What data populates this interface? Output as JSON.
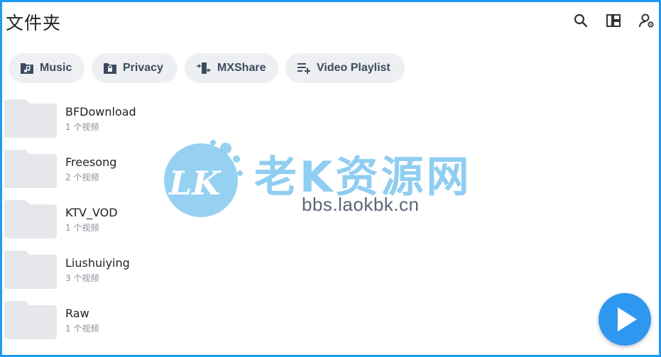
{
  "header": {
    "title": "文件夹",
    "icons": [
      "search-icon",
      "layout-icon",
      "account-settings-icon"
    ]
  },
  "chips": [
    {
      "label": "Music",
      "icon": "music-folder-icon"
    },
    {
      "label": "Privacy",
      "icon": "lock-folder-icon"
    },
    {
      "label": "MXShare",
      "icon": "share-transfer-icon"
    },
    {
      "label": "Video Playlist",
      "icon": "playlist-add-icon"
    }
  ],
  "folders": [
    {
      "name": "BFDownload",
      "count": "1 个视频"
    },
    {
      "name": "Freesong",
      "count": "2 个视频"
    },
    {
      "name": "KTV_VOD",
      "count": "1 个视频"
    },
    {
      "name": "Liushuiying",
      "count": "3 个视频"
    },
    {
      "name": "Raw",
      "count": "1 个视频"
    }
  ],
  "watermark": {
    "logo_text": "LK",
    "title": "老K资源网",
    "url": "bbs.laokbk.cn"
  },
  "fab": {
    "icon": "play-icon"
  },
  "colors": {
    "accent": "#2e97f0",
    "border": "#1e9cf5",
    "chip_bg": "#eeeff2",
    "folder": "#e5e7ea"
  }
}
